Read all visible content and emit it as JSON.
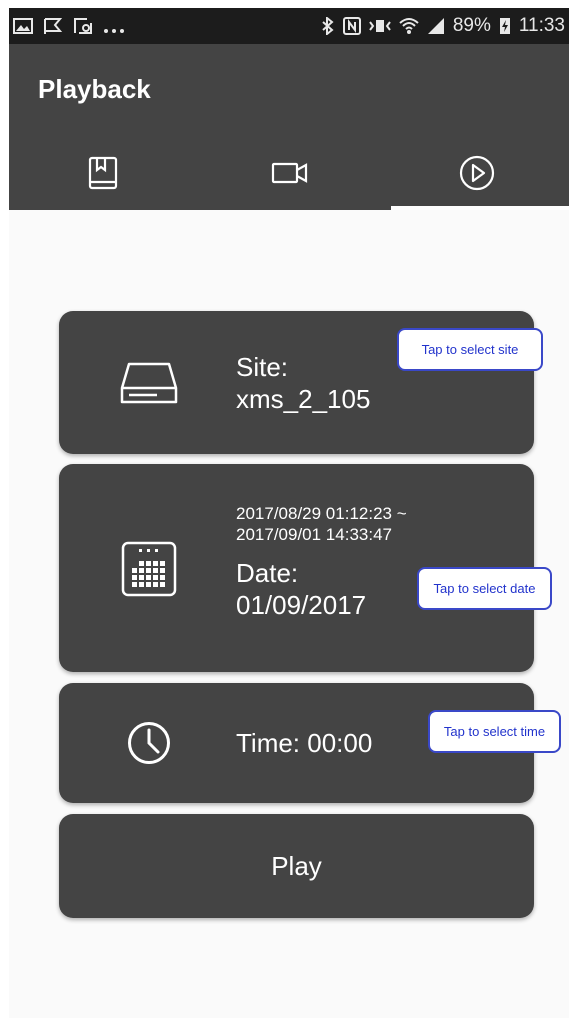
{
  "status_bar": {
    "battery": "89%",
    "time": "11:33",
    "left_icons": [
      "image-icon",
      "flag-icon",
      "screenshot-icon",
      "more-dots"
    ],
    "right_icons": [
      "bluetooth-icon",
      "nfc-icon",
      "vibrate-icon",
      "wifi-icon",
      "signal-icon",
      "battery-charging-icon"
    ]
  },
  "app_bar": {
    "title": "Playback",
    "tabs": [
      {
        "icon": "bookmark-book-icon",
        "selected": false
      },
      {
        "icon": "video-camera-icon",
        "selected": false
      },
      {
        "icon": "play-circle-icon",
        "selected": true
      }
    ]
  },
  "site_card": {
    "label": "Site:",
    "value": "xms_2_105",
    "icon": "hard-drive-icon",
    "tooltip": "Tap to select site"
  },
  "date_card": {
    "range_start": "2017/08/29 01:12:23 ~",
    "range_end": "2017/09/01 14:33:47",
    "label": "Date:",
    "value": "01/09/2017",
    "icon": "calendar-icon",
    "tooltip": "Tap to select date"
  },
  "time_card": {
    "text": "Time:  00:00",
    "icon": "clock-icon",
    "tooltip": "Tap to select time"
  },
  "play_button": {
    "label": "Play"
  },
  "colors": {
    "app_bar": "#444444",
    "status_bar": "#1c1c1c",
    "card": "#444444",
    "tooltip_border": "#3a48c8",
    "tooltip_text": "#2233cc",
    "background": "#fafafa"
  }
}
